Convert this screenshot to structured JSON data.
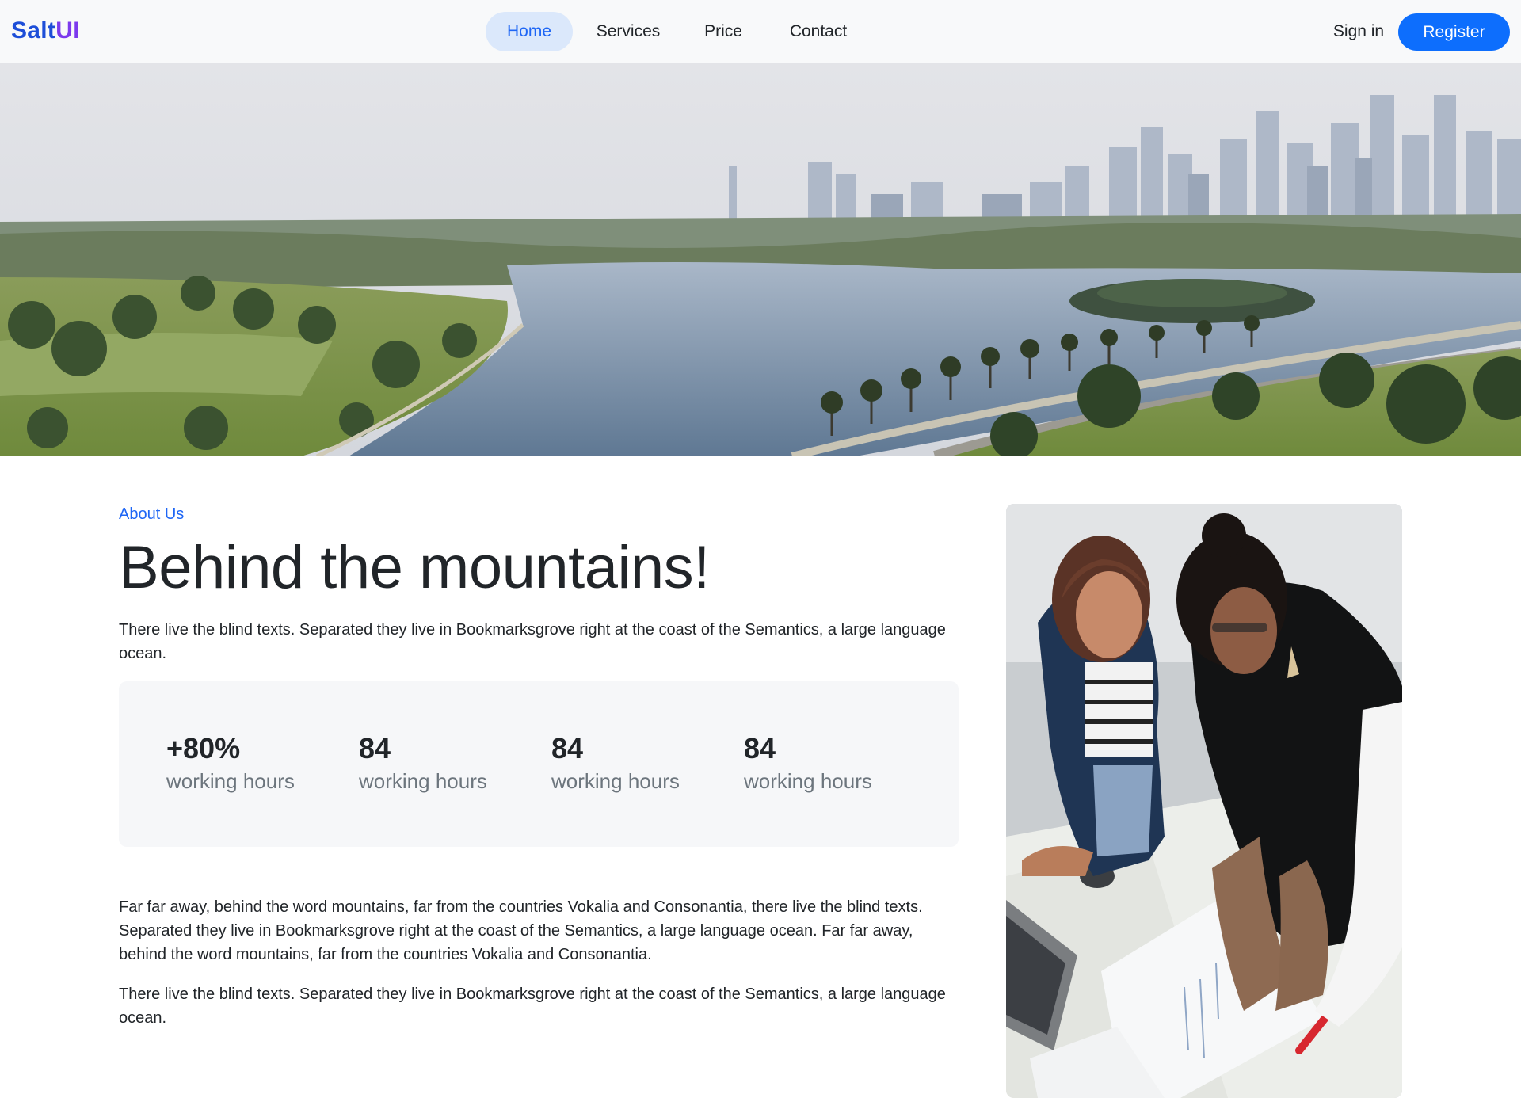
{
  "navbar": {
    "brand_part1": "Salt",
    "brand_part2": "UI",
    "links": [
      {
        "label": "Home",
        "active": true
      },
      {
        "label": "Services",
        "active": false
      },
      {
        "label": "Price",
        "active": false
      },
      {
        "label": "Contact",
        "active": false
      }
    ],
    "signin_label": "Sign in",
    "register_label": "Register"
  },
  "about": {
    "eyebrow": "About Us",
    "title": "Behind the mountains!",
    "lead": "There live the blind texts. Separated they live in Bookmarksgrove right at the coast of the Semantics, a large language ocean.",
    "stats": [
      {
        "value": "+80%",
        "label": "working hours"
      },
      {
        "value": "84",
        "label": "working hours"
      },
      {
        "value": "84",
        "label": "working hours"
      },
      {
        "value": "84",
        "label": "working hours"
      }
    ],
    "paragraph1": "Far far away, behind the word mountains, far from the countries Vokalia and Consonantia, there live the blind texts. Separated they live in Bookmarksgrove right at the coast of the Semantics, a large language ocean. Far far away, behind the word mountains, far from the countries Vokalia and Consonantia.",
    "paragraph2": "There live the blind texts. Separated they live in Bookmarksgrove right at the coast of the Semantics, a large language ocean."
  },
  "colors": {
    "accent": "#0d6efd",
    "accent_text": "#1e66f5",
    "nav_active_bg": "#dbe8fb",
    "stats_bg": "#f6f7f9"
  }
}
